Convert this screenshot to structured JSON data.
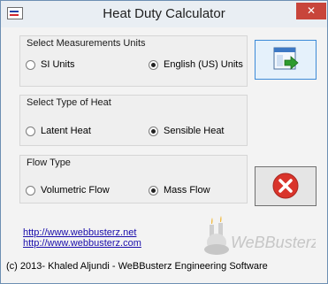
{
  "window": {
    "title": "Heat Duty Calculator",
    "close_glyph": "✕"
  },
  "units_group": {
    "title": "Select Measurements Units",
    "options": [
      {
        "label": "SI Units",
        "checked": false
      },
      {
        "label": "English (US) Units",
        "checked": true
      }
    ]
  },
  "heat_group": {
    "title": "Select Type of Heat",
    "options": [
      {
        "label": "Latent Heat",
        "checked": false
      },
      {
        "label": "Sensible Heat",
        "checked": true
      }
    ]
  },
  "flow_group": {
    "title": "Flow Type",
    "options": [
      {
        "label": "Volumetric Flow",
        "checked": false
      },
      {
        "label": "Mass Flow",
        "checked": true
      }
    ]
  },
  "links": [
    "http://www.webbusterz.net",
    "http://www.webbusterz.com"
  ],
  "footer": "(c) 2013- Khaled Aljundi - WeBBusterz Engineering Software",
  "logo_text": "WeBBusterz",
  "icons": {
    "go": "window-arrow-icon",
    "exit": "red-x-icon"
  },
  "colors": {
    "close_button": "#c8453b",
    "link": "#1a0dab",
    "go_arrow": "#2e9b2e",
    "exit_red": "#d9342b"
  }
}
